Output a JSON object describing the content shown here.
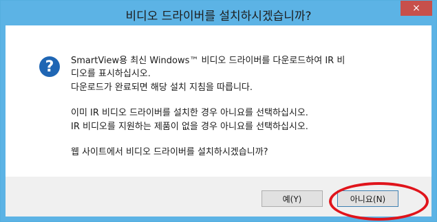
{
  "title": "비디오 드라이버를 설치하시겠습니까?",
  "close_glyph": "×",
  "icon_glyph": "?",
  "message": {
    "line1": "SmartView용 최신 Windows™ 비디오 드라이버를 다운로드하여 IR 비",
    "line2": "디오를 표시하십시오.",
    "line3": "다운로드가 완료되면 해당 설치 지침을 따릅니다.",
    "line4": "이미 IR 비디오 드라이버를 설치한 경우 아니요를 선택하십시오.",
    "line5": "IR 비디오를 지원하는 제품이 없을 경우 아니요를 선택하십시오.",
    "line6": "웹 사이트에서 비디오 드라이버를 설치하시겠습니까?"
  },
  "buttons": {
    "yes": "예(Y)",
    "no": "아니요(N)"
  },
  "colors": {
    "titlebar": "#5cb3e5",
    "close": "#c7504b",
    "annotation": "#e0141b"
  }
}
